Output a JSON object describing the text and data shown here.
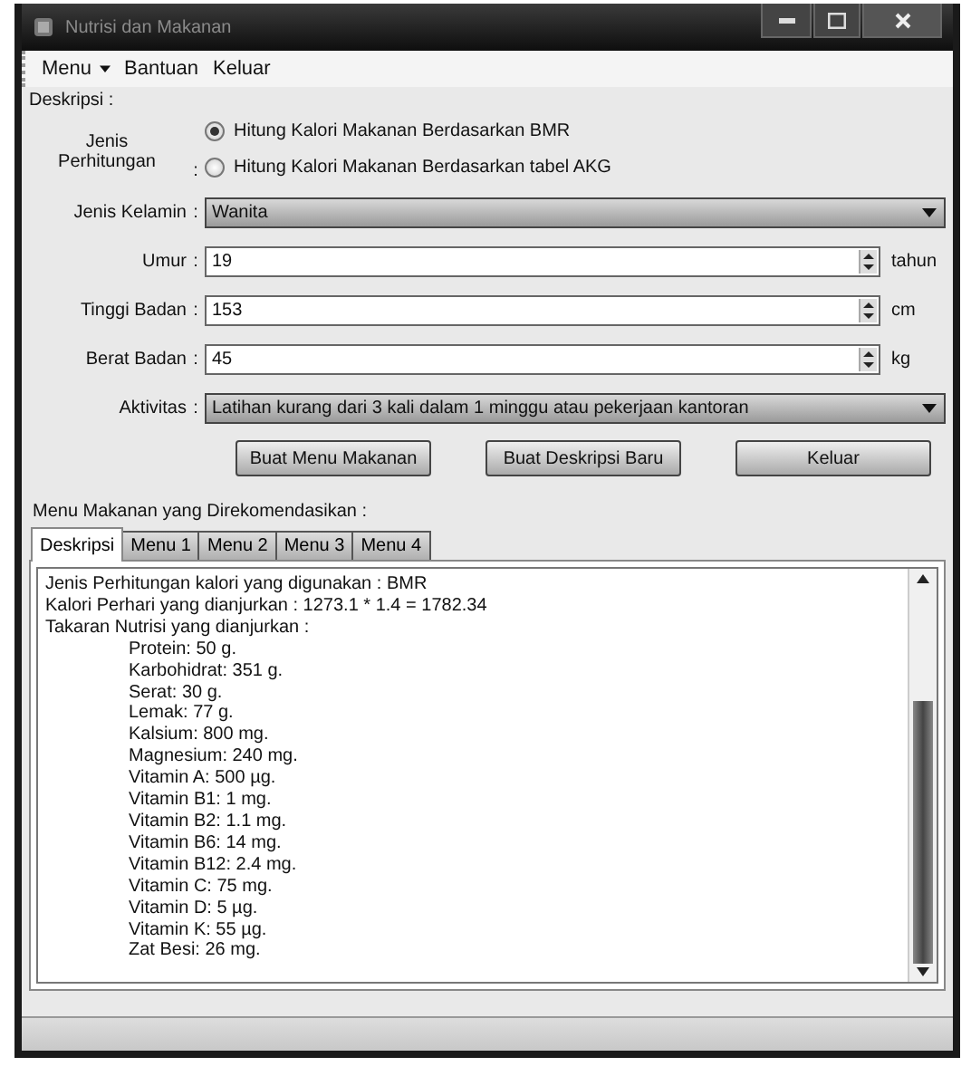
{
  "window": {
    "title": "Nutrisi dan Makanan"
  },
  "menu": [
    {
      "label": "Menu",
      "dropdown": true
    },
    {
      "label": "Bantuan",
      "dropdown": false
    },
    {
      "label": "Keluar",
      "dropdown": false
    }
  ],
  "description_label": "Deskripsi :",
  "calculation_type": {
    "label": "Jenis Perhitungan",
    "colon": ":",
    "options": [
      {
        "label": "Hitung Kalori Makanan Berdasarkan BMR",
        "selected": true
      },
      {
        "label": "Hitung Kalori Makanan Berdasarkan tabel AKG",
        "selected": false
      }
    ]
  },
  "fields": [
    {
      "kind": "combo",
      "label": "Jenis Kelamin",
      "colon": ":",
      "value": "Wanita"
    },
    {
      "kind": "spin",
      "label": "Umur",
      "colon": ":",
      "value": "19",
      "unit": "tahun"
    },
    {
      "kind": "spin",
      "label": "Tinggi Badan",
      "colon": ":",
      "value": "153",
      "unit": "cm"
    },
    {
      "kind": "spin",
      "label": "Berat Badan",
      "colon": ":",
      "value": "45",
      "unit": "kg"
    },
    {
      "kind": "combo",
      "label": "Aktivitas",
      "colon": ":",
      "value": "Latihan kurang dari 3 kali dalam 1 minggu atau pekerjaan kantoran"
    }
  ],
  "buttons": [
    "Buat Menu Makanan",
    "Buat Deskripsi Baru",
    "Keluar"
  ],
  "result_label": "Menu Makanan yang Direkomendasikan :",
  "tabs": [
    {
      "label": "Deskripsi",
      "selected": true
    },
    {
      "label": "Menu 1",
      "selected": false
    },
    {
      "label": "Menu 2",
      "selected": false
    },
    {
      "label": "Menu 3",
      "selected": false
    },
    {
      "label": "Menu 4",
      "selected": false
    }
  ],
  "result_lines": [
    {
      "text": "Jenis Perhitungan kalori yang digunakan : BMR"
    },
    {
      "text": "Kalori Perhari yang dianjurkan : 1273.1 * 1.4 = 1782.34"
    },
    {
      "text": "Takaran Nutrisi yang dianjurkan :",
      "children": [
        {
          "text": "Protein: 50 g."
        },
        {
          "text": "Karbohidrat: 351 g."
        },
        {
          "text": "Serat: 30 g."
        },
        {
          "text": "Lemak: 77 g."
        },
        {
          "text": "Kalsium: 800 mg."
        },
        {
          "text": "Magnesium: 240 mg."
        },
        {
          "text": "Vitamin A: 500 µg."
        },
        {
          "text": "Vitamin B1: 1 mg."
        },
        {
          "text": "Vitamin B2: 1.1 mg."
        },
        {
          "text": "Vitamin B6: 14 mg."
        },
        {
          "text": "Vitamin B12: 2.4 mg."
        },
        {
          "text": "Vitamin C: 75 mg."
        },
        {
          "text": "Vitamin D: 5 µg."
        },
        {
          "text": "Vitamin K: 55 µg."
        },
        {
          "text": "Zat Besi: 26 mg."
        }
      ]
    }
  ]
}
